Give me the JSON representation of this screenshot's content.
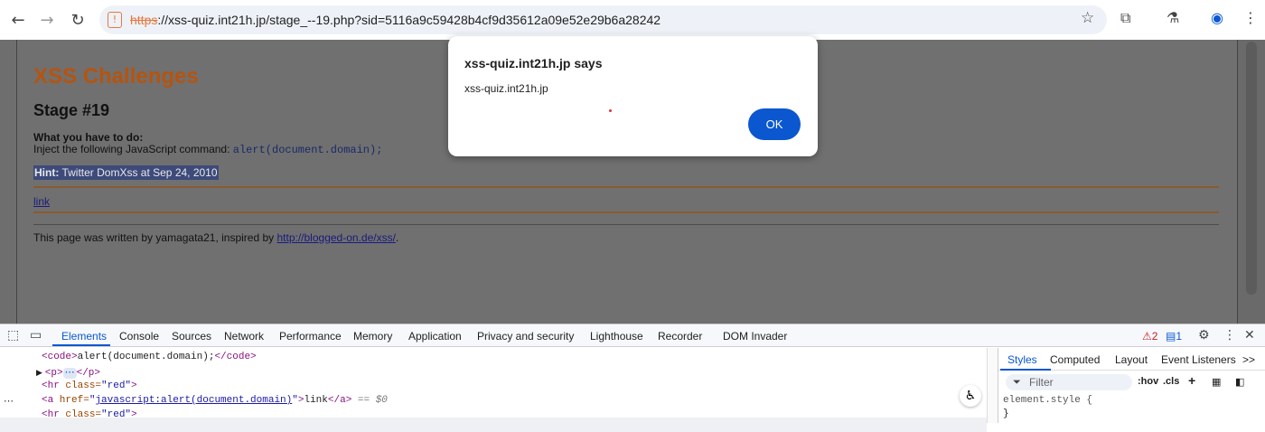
{
  "browser": {
    "url_scheme": "https",
    "url_rest": "://xss-quiz.int21h.jp/stage_--19.php?sid=5116a9c59428b4cf9d35612a09e52e29b6a28242",
    "icons": {
      "back": "arrow-left-icon",
      "forward": "arrow-right-icon",
      "reload": "reload-icon",
      "site": "not-secure-icon",
      "bookmark": "star-icon",
      "extensions": "puzzle-icon",
      "labs": "flask-icon",
      "profile": "profile-icon",
      "menu": "kebab-menu-icon"
    }
  },
  "page": {
    "title": "XSS Challenges",
    "stage": "Stage #19",
    "todo_heading": "What you have to do:",
    "todo_text": "Inject the following JavaScript command: ",
    "todo_code": "alert(document.domain);",
    "hint_label": "Hint:",
    "hint_text": " Twitter DomXss at Sep 24, 2010 ",
    "link_text": "link",
    "footer_text": "This page was written by yamagata21, inspired by ",
    "footer_link": "http://blogged-on.de/xss/",
    "footer_period": ".",
    "colors": {
      "title": "#b55410",
      "hint_bg": "#3d4a7a"
    }
  },
  "dialog": {
    "title": "xss-quiz.int21h.jp says",
    "message": "xss-quiz.int21h.jp",
    "ok_label": "OK",
    "ok_color": "#0b57d0"
  },
  "devtools": {
    "tabs": [
      "Elements",
      "Console",
      "Sources",
      "Network",
      "Performance",
      "Memory",
      "Application",
      "Privacy and security",
      "Lighthouse",
      "Recorder",
      "DOM Invader"
    ],
    "active_tab": "Elements",
    "warnings_count": "2",
    "messages_count": "1",
    "code": {
      "line1_open": "<code>",
      "line1_text": "alert(document.domain);",
      "line1_close": "</code>",
      "line2_open": "<p>",
      "line2_ellipsis": "⋯",
      "line2_close": "</p>",
      "line3_tag": "<hr",
      "line3_attr": " class=",
      "line3_val": "\"red\"",
      "line3_end": ">",
      "line4_tag": "<a",
      "line4_attr": " href=",
      "line4_q1": "\"",
      "line4_val": "javascript:alert(document.domain)",
      "line4_q2": "\"",
      "line4_gt": ">",
      "line4_text": "link",
      "line4_close": "</a>",
      "line4_eq": " == $0",
      "line5_tag": "<hr",
      "line5_attr": " class=",
      "line5_val": "\"red\"",
      "line5_end": ">",
      "gutter_dots": "⋯"
    },
    "side_tabs": [
      "Styles",
      "Computed",
      "Layout",
      "Event Listeners"
    ],
    "side_more": ">>",
    "filter_placeholder": "Filter",
    "hov": ":hov",
    "cls": ".cls",
    "plus": "+",
    "element_style": "element.style {",
    "close_brace": "}"
  }
}
